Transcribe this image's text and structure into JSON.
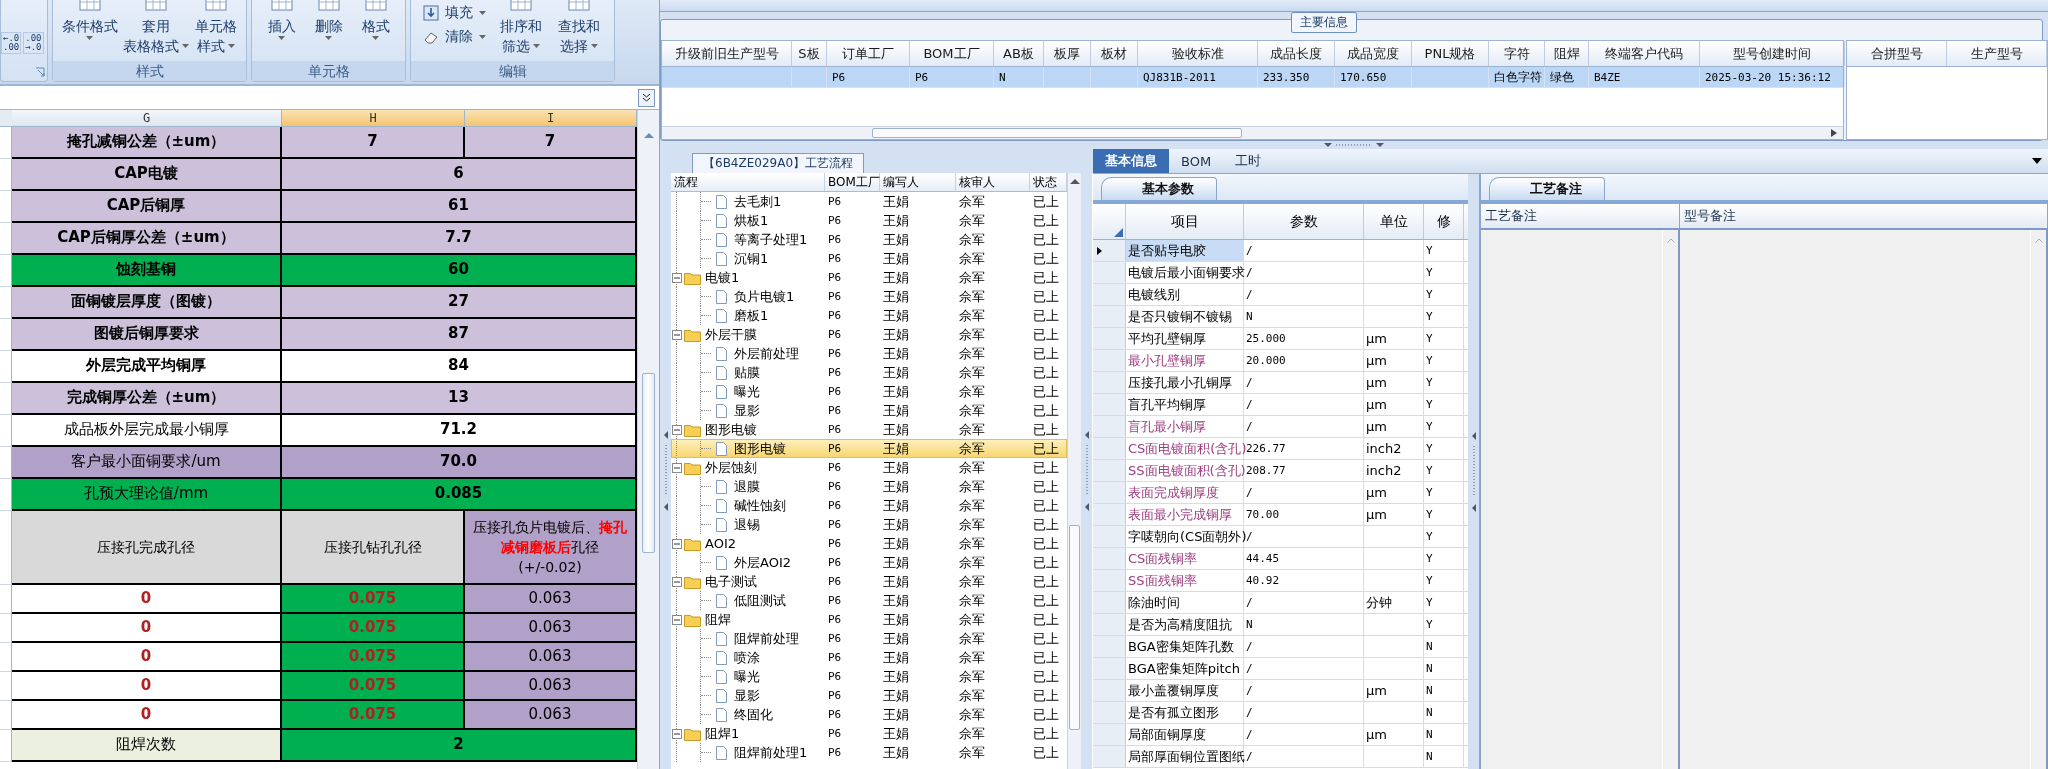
{
  "ribbon": {
    "decimal_buttons": [
      {
        "top": "←.0",
        "bottom": ".00"
      },
      {
        "top": ".00",
        "bottom": "→.0"
      }
    ],
    "groups": [
      {
        "label": "样式",
        "buttons": [
          {
            "kind": "large",
            "lines": [
              "条件格式"
            ]
          },
          {
            "kind": "large",
            "lines": [
              "套用",
              "表格格式"
            ]
          },
          {
            "kind": "large",
            "lines": [
              "单元格",
              "样式"
            ]
          }
        ]
      },
      {
        "label": "单元格",
        "buttons": [
          {
            "kind": "large",
            "lines": [
              "插入"
            ]
          },
          {
            "kind": "large",
            "lines": [
              "删除"
            ]
          },
          {
            "kind": "large",
            "lines": [
              "格式"
            ]
          }
        ]
      },
      {
        "label": "编辑",
        "buttons": [
          {
            "kind": "small",
            "lines": [
              "填充"
            ]
          },
          {
            "kind": "small",
            "lines": [
              "清除"
            ]
          },
          {
            "kind": "large",
            "lines": [
              "排序和",
              "筛选"
            ]
          },
          {
            "kind": "large",
            "lines": [
              "查找和",
              "选择"
            ]
          }
        ]
      }
    ]
  },
  "sheet": {
    "columns": [
      {
        "label": "G",
        "selected": false
      },
      {
        "label": "H",
        "selected": true
      },
      {
        "label": "I",
        "selected": true
      }
    ],
    "rows": [
      {
        "kind": "pair",
        "cells": [
          {
            "text": "掩孔减铜公差（±um）",
            "kind": "lavender",
            "bold": true
          },
          {
            "text": "7",
            "kind": "lavender",
            "bold": true
          },
          {
            "text": "7",
            "kind": "lavender",
            "bold": true
          }
        ]
      },
      {
        "kind": "merged",
        "cells": [
          {
            "text": "CAP电镀",
            "kind": "lavender",
            "bold": true
          },
          {
            "text": "6",
            "kind": "lavender",
            "bold": true
          }
        ]
      },
      {
        "kind": "merged",
        "cells": [
          {
            "text": "CAP后铜厚",
            "kind": "lavender",
            "bold": true
          },
          {
            "text": "61",
            "kind": "lavender",
            "bold": true
          }
        ]
      },
      {
        "kind": "merged",
        "cells": [
          {
            "text": "CAP后铜厚公差（±um）",
            "kind": "lavender",
            "bold": true
          },
          {
            "text": "7.7",
            "kind": "lavender",
            "bold": true
          }
        ]
      },
      {
        "kind": "merged",
        "cells": [
          {
            "text": "蚀刻基铜",
            "kind": "green",
            "bold": true
          },
          {
            "text": "60",
            "kind": "green",
            "bold": true
          }
        ]
      },
      {
        "kind": "merged",
        "cells": [
          {
            "text": "面铜镀层厚度（图镀）",
            "kind": "lavender",
            "bold": true
          },
          {
            "text": "27",
            "kind": "lavender",
            "bold": true
          }
        ]
      },
      {
        "kind": "merged",
        "cells": [
          {
            "text": "图镀后铜厚要求",
            "kind": "lavender",
            "bold": true
          },
          {
            "text": "87",
            "kind": "lavender",
            "bold": true
          }
        ]
      },
      {
        "kind": "merged",
        "cells": [
          {
            "text": "外层完成平均铜厚",
            "kind": "plain",
            "bold": true
          },
          {
            "text": "84",
            "kind": "plain",
            "bold": true
          }
        ]
      },
      {
        "kind": "merged",
        "cells": [
          {
            "text": "完成铜厚公差（±um）",
            "kind": "lavender",
            "bold": true
          },
          {
            "text": "13",
            "kind": "lavender",
            "bold": true
          }
        ]
      },
      {
        "kind": "merged",
        "cells": [
          {
            "text": "成品板外层完成最小铜厚",
            "kind": "plain",
            "bold": false
          },
          {
            "text": "71.2",
            "kind": "plain",
            "bold": true
          }
        ]
      },
      {
        "kind": "merged",
        "cells": [
          {
            "text": "客户最小面铜要求/um",
            "kind": "violet",
            "bold": false
          },
          {
            "text": "70.0",
            "kind": "violet",
            "bold": true
          }
        ]
      },
      {
        "kind": "merged",
        "cells": [
          {
            "text": "孔预大理论值/mm",
            "kind": "green",
            "bold": false
          },
          {
            "text": "0.085",
            "kind": "green",
            "bold": true
          }
        ]
      },
      {
        "kind": "header",
        "cells": [
          {
            "text": "压接孔完成孔径",
            "kind": "grey",
            "bold": false
          },
          {
            "text": "压接孔钻孔孔径",
            "kind": "grey",
            "bold": false
          },
          {
            "text": "压接孔负片电镀后、**掩孔减铜磨板后**孔径\n(+/-0.02)",
            "kind": "violet",
            "bold": false
          }
        ]
      },
      {
        "kind": "triple",
        "cells": [
          {
            "text": "0",
            "kind": "plain",
            "bold": true,
            "warning": true
          },
          {
            "text": "0.075",
            "kind": "green",
            "bold": true,
            "warning": true
          },
          {
            "text": "0.063",
            "kind": "violet",
            "bold": false,
            "warning": false
          }
        ]
      },
      {
        "kind": "triple",
        "cells": [
          {
            "text": "0",
            "kind": "plain",
            "bold": true,
            "warning": true
          },
          {
            "text": "0.075",
            "kind": "green",
            "bold": true,
            "warning": true
          },
          {
            "text": "0.063",
            "kind": "violet",
            "bold": false,
            "warning": false
          }
        ]
      },
      {
        "kind": "triple",
        "cells": [
          {
            "text": "0",
            "kind": "plain",
            "bold": true,
            "warning": true
          },
          {
            "text": "0.075",
            "kind": "green",
            "bold": true,
            "warning": true
          },
          {
            "text": "0.063",
            "kind": "violet",
            "bold": false,
            "warning": false
          }
        ]
      },
      {
        "kind": "triple",
        "cells": [
          {
            "text": "0",
            "kind": "plain",
            "bold": true,
            "warning": true
          },
          {
            "text": "0.075",
            "kind": "green",
            "bold": true,
            "warning": true
          },
          {
            "text": "0.063",
            "kind": "violet",
            "bold": false,
            "warning": false
          }
        ]
      },
      {
        "kind": "triple",
        "cells": [
          {
            "text": "0",
            "kind": "plain",
            "bold": true,
            "warning": true
          },
          {
            "text": "0.075",
            "kind": "green",
            "bold": true,
            "warning": true
          },
          {
            "text": "0.063",
            "kind": "violet",
            "bold": false,
            "warning": false
          }
        ]
      },
      {
        "kind": "merged",
        "cells": [
          {
            "text": "阻焊次数",
            "kind": "pale",
            "bold": false
          },
          {
            "text": "2",
            "kind": "green",
            "bold": true
          }
        ]
      }
    ]
  },
  "main_info": {
    "title": "主要信息",
    "columns": [
      "升级前旧生产型号",
      "S板",
      "订单工厂",
      "BOM工厂",
      "AB板",
      "板厚",
      "板材",
      "验收标准",
      "成品长度",
      "成品宽度",
      "PNL规格",
      "字符",
      "阻焊",
      "终端客户代码",
      "型号创建时间"
    ],
    "rows": [
      {
        "selected": true,
        "cells": [
          null,
          null,
          "P6",
          "P6",
          "N",
          null,
          null,
          "QJ831B-2011",
          "233.350",
          "170.650",
          null,
          "白色字符",
          "绿色",
          "B4ZE",
          "2025-03-20 15:36:12"
        ]
      }
    ],
    "side_columns": [
      "合拼型号",
      "生产型号"
    ]
  },
  "process": {
    "title": "【6B4ZE029A0】工艺流程",
    "columns": [
      "流程",
      "BOM工厂",
      "编写人",
      "核审人",
      "状态"
    ],
    "tree": [
      {
        "kind": "hidden",
        "children": [
          {
            "kind": "file",
            "label": "去毛刺1",
            "selected": false,
            "bom": "P6",
            "writer": "王娟",
            "reviewer": "佘军",
            "status": "已上"
          },
          {
            "kind": "file",
            "label": "烘板1",
            "selected": false,
            "bom": "P6",
            "writer": "王娟",
            "reviewer": "佘军",
            "status": "已上"
          },
          {
            "kind": "file",
            "label": "等离子处理1",
            "selected": false,
            "bom": "P6",
            "writer": "王娟",
            "reviewer": "佘军",
            "status": "已上"
          },
          {
            "kind": "file",
            "label": "沉铜1",
            "selected": false,
            "bom": "P6",
            "writer": "王娟",
            "reviewer": "佘军",
            "status": "已上"
          }
        ]
      },
      {
        "kind": "folder",
        "label": "电镀1",
        "selected": false,
        "expanded": true,
        "bom": "P6",
        "writer": "王娟",
        "reviewer": "佘军",
        "status": "已上",
        "children": [
          {
            "kind": "file",
            "label": "负片电镀1",
            "selected": false,
            "bom": "P6",
            "writer": "王娟",
            "reviewer": "佘军",
            "status": "已上"
          },
          {
            "kind": "file",
            "label": "磨板1",
            "selected": false,
            "bom": "P6",
            "writer": "王娟",
            "reviewer": "佘军",
            "status": "已上"
          }
        ]
      },
      {
        "kind": "folder",
        "label": "外层干膜",
        "selected": false,
        "expanded": true,
        "bom": "P6",
        "writer": "王娟",
        "reviewer": "佘军",
        "status": "已上",
        "children": [
          {
            "kind": "file",
            "label": "外层前处理",
            "selected": false,
            "bom": "P6",
            "writer": "王娟",
            "reviewer": "佘军",
            "status": "已上"
          },
          {
            "kind": "file",
            "label": "贴膜",
            "selected": false,
            "bom": "P6",
            "writer": "王娟",
            "reviewer": "佘军",
            "status": "已上"
          },
          {
            "kind": "file",
            "label": "曝光",
            "selected": false,
            "bom": "P6",
            "writer": "王娟",
            "reviewer": "佘军",
            "status": "已上"
          },
          {
            "kind": "file",
            "label": "显影",
            "selected": false,
            "bom": "P6",
            "writer": "王娟",
            "reviewer": "佘军",
            "status": "已上"
          }
        ]
      },
      {
        "kind": "folder",
        "label": "图形电镀",
        "selected": false,
        "expanded": true,
        "bom": "P6",
        "writer": "王娟",
        "reviewer": "佘军",
        "status": "已上",
        "children": [
          {
            "kind": "file",
            "label": "图形电镀",
            "selected": true,
            "bom": "P6",
            "writer": "王娟",
            "reviewer": "佘军",
            "status": "已上"
          }
        ]
      },
      {
        "kind": "folder",
        "label": "外层蚀刻",
        "selected": false,
        "expanded": true,
        "bom": "P6",
        "writer": "王娟",
        "reviewer": "佘军",
        "status": "已上",
        "children": [
          {
            "kind": "file",
            "label": "退膜",
            "selected": false,
            "bom": "P6",
            "writer": "王娟",
            "reviewer": "佘军",
            "status": "已上"
          },
          {
            "kind": "file",
            "label": "碱性蚀刻",
            "selected": false,
            "bom": "P6",
            "writer": "王娟",
            "reviewer": "佘军",
            "status": "已上"
          },
          {
            "kind": "file",
            "label": "退锡",
            "selected": false,
            "bom": "P6",
            "writer": "王娟",
            "reviewer": "佘军",
            "status": "已上"
          }
        ]
      },
      {
        "kind": "folder",
        "label": "AOI2",
        "selected": false,
        "expanded": true,
        "bom": "P6",
        "writer": "王娟",
        "reviewer": "佘军",
        "status": "已上",
        "children": [
          {
            "kind": "file",
            "label": "外层AOI2",
            "selected": false,
            "bom": "P6",
            "writer": "王娟",
            "reviewer": "佘军",
            "status": "已上"
          }
        ]
      },
      {
        "kind": "folder",
        "label": "电子测试",
        "selected": false,
        "expanded": true,
        "bom": "P6",
        "writer": "王娟",
        "reviewer": "佘军",
        "status": "已上",
        "children": [
          {
            "kind": "file",
            "label": "低阻测试",
            "selected": false,
            "bom": "P6",
            "writer": "王娟",
            "reviewer": "佘军",
            "status": "已上"
          }
        ]
      },
      {
        "kind": "folder",
        "label": "阻焊",
        "selected": false,
        "expanded": true,
        "bom": "P6",
        "writer": "王娟",
        "reviewer": "佘军",
        "status": "已上",
        "children": [
          {
            "kind": "file",
            "label": "阻焊前处理",
            "selected": false,
            "bom": "P6",
            "writer": "王娟",
            "reviewer": "佘军",
            "status": "已上"
          },
          {
            "kind": "file",
            "label": "喷涂",
            "selected": false,
            "bom": "P6",
            "writer": "王娟",
            "reviewer": "佘军",
            "status": "已上"
          },
          {
            "kind": "file",
            "label": "曝光",
            "selected": false,
            "bom": "P6",
            "writer": "王娟",
            "reviewer": "佘军",
            "status": "已上"
          },
          {
            "kind": "file",
            "label": "显影",
            "selected": false,
            "bom": "P6",
            "writer": "王娟",
            "reviewer": "佘军",
            "status": "已上"
          },
          {
            "kind": "file",
            "label": "终固化",
            "selected": false,
            "bom": "P6",
            "writer": "王娟",
            "reviewer": "佘军",
            "status": "已上"
          }
        ]
      },
      {
        "kind": "folder",
        "label": "阻焊1",
        "selected": false,
        "expanded": true,
        "bom": "P6",
        "writer": "王娟",
        "reviewer": "佘军",
        "status": "已上",
        "children": [
          {
            "kind": "file",
            "label": "阻焊前处理1",
            "selected": false,
            "bom": "P6",
            "writer": "王娟",
            "reviewer": "佘军",
            "status": "已上"
          }
        ]
      }
    ]
  },
  "detail_tabs": [
    {
      "label": "基本信息",
      "selected": true
    },
    {
      "label": "BOM",
      "selected": false
    },
    {
      "label": "工时",
      "selected": false
    }
  ],
  "basic_params": {
    "tab": "基本参数",
    "columns": [
      "项目",
      "参数",
      "单位",
      "修"
    ],
    "rows": [
      {
        "item": "是否贴导电胶",
        "value": "/",
        "modifiable": "Y",
        "highlighted": false,
        "selected": true
      },
      {
        "item": "电镀后最小面铜要求",
        "value": "/",
        "modifiable": "Y",
        "highlighted": false,
        "selected": false
      },
      {
        "item": "电镀线别",
        "value": "/",
        "modifiable": "Y",
        "highlighted": false,
        "selected": false
      },
      {
        "item": "是否只镀铜不镀锡",
        "value": "N",
        "modifiable": "Y",
        "highlighted": false,
        "selected": false
      },
      {
        "item": "平均孔壁铜厚",
        "value": "25.000",
        "unit": "μm",
        "modifiable": "Y",
        "highlighted": false,
        "selected": false
      },
      {
        "item": "最小孔壁铜厚",
        "value": "20.000",
        "unit": "μm",
        "modifiable": "Y",
        "highlighted": true,
        "selected": false
      },
      {
        "item": "压接孔最小孔铜厚",
        "value": "/",
        "unit": "μm",
        "modifiable": "Y",
        "highlighted": false,
        "selected": false
      },
      {
        "item": "盲孔平均铜厚",
        "value": "/",
        "unit": "μm",
        "modifiable": "Y",
        "highlighted": false,
        "selected": false
      },
      {
        "item": "盲孔最小铜厚",
        "value": "/",
        "unit": "μm",
        "modifiable": "Y",
        "highlighted": true,
        "selected": false
      },
      {
        "item": "CS面电镀面积(含孔)",
        "value": "226.77",
        "unit": "inch2",
        "modifiable": "Y",
        "highlighted": true,
        "selected": false
      },
      {
        "item": "SS面电镀面积(含孔)",
        "value": "208.77",
        "unit": "inch2",
        "modifiable": "Y",
        "highlighted": true,
        "selected": false
      },
      {
        "item": "表面完成铜厚度",
        "value": "/",
        "unit": "μm",
        "modifiable": "Y",
        "highlighted": true,
        "selected": false
      },
      {
        "item": "表面最小完成铜厚",
        "value": "70.00",
        "unit": "μm",
        "modifiable": "Y",
        "highlighted": true,
        "selected": false
      },
      {
        "item": "字唛朝向(CS面朝外)",
        "value": "/",
        "modifiable": "Y",
        "highlighted": false,
        "selected": false
      },
      {
        "item": "CS面残铜率",
        "value": "44.45",
        "modifiable": "Y",
        "highlighted": true,
        "selected": false
      },
      {
        "item": "SS面残铜率",
        "value": "40.92",
        "modifiable": "Y",
        "highlighted": true,
        "selected": false
      },
      {
        "item": "除油时间",
        "value": "/",
        "unit": "分钟",
        "modifiable": "Y",
        "highlighted": false,
        "selected": false
      },
      {
        "item": "是否为高精度阻抗",
        "value": "N",
        "modifiable": "Y",
        "highlighted": false,
        "selected": false
      },
      {
        "item": "BGA密集矩阵孔数",
        "value": "/",
        "modifiable": "N",
        "highlighted": false,
        "selected": false
      },
      {
        "item": "BGA密集矩阵pitch",
        "value": "/",
        "modifiable": "N",
        "highlighted": false,
        "selected": false
      },
      {
        "item": "最小盖覆铜厚度",
        "value": "/",
        "unit": "μm",
        "modifiable": "N",
        "highlighted": false,
        "selected": false
      },
      {
        "item": "是否有孤立图形",
        "value": "/",
        "modifiable": "N",
        "highlighted": false,
        "selected": false
      },
      {
        "item": "局部面铜厚度",
        "value": "/",
        "unit": "μm",
        "modifiable": "N",
        "highlighted": false,
        "selected": false
      },
      {
        "item": "局部厚面铜位置图纸",
        "value": "/",
        "modifiable": "N",
        "highlighted": false,
        "selected": false
      }
    ]
  },
  "notes": {
    "tab": "工艺备注",
    "columns": [
      "工艺备注",
      "型号备注"
    ]
  }
}
